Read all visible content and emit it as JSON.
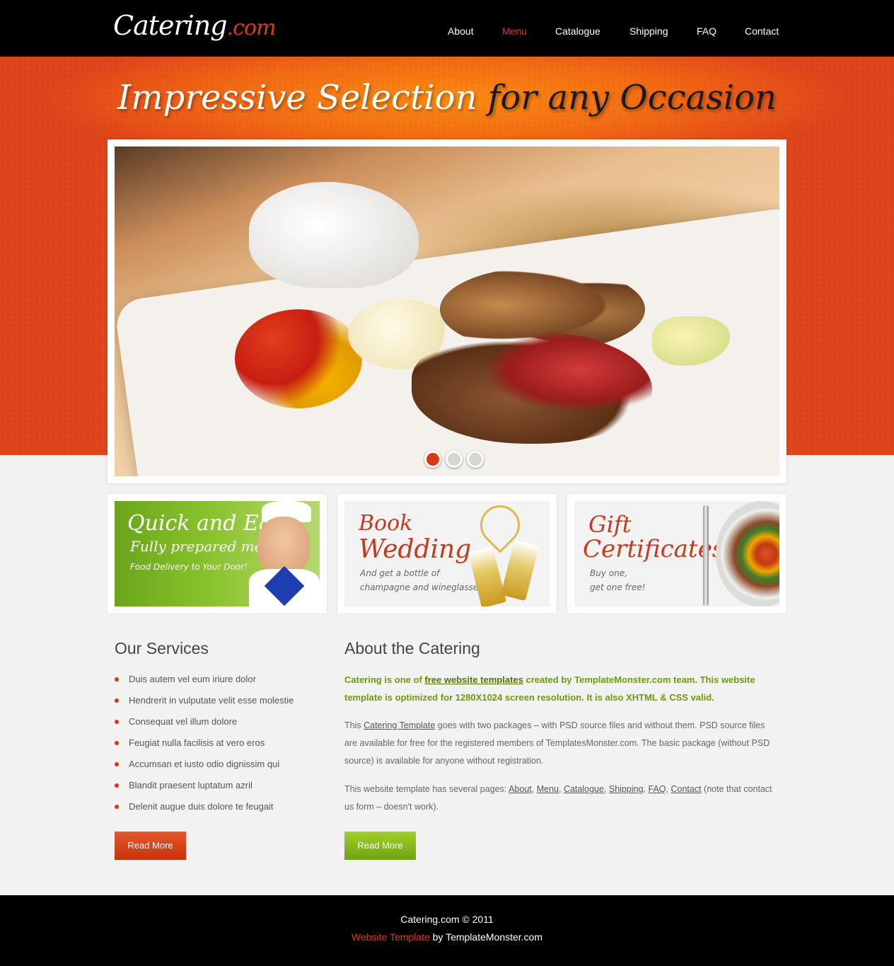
{
  "header": {
    "logo_main": "Catering",
    "logo_suffix": ".com",
    "nav": [
      {
        "label": "About"
      },
      {
        "label": "Menu"
      },
      {
        "label": "Catalogue"
      },
      {
        "label": "Shipping"
      },
      {
        "label": "FAQ"
      },
      {
        "label": "Contact"
      }
    ],
    "active_nav": "Menu"
  },
  "hero": {
    "tagline_part1": "Impressive Selection",
    "tagline_part2": "for any Occasion",
    "slide_count": 3,
    "active_slide": 1
  },
  "promos": [
    {
      "title1": "Quick and Easy",
      "title2": "Fully prepared meals",
      "text": "Food Delivery to Your Door!"
    },
    {
      "title1": "Book",
      "title2": "Wedding",
      "text1": "And get a bottle of",
      "text2": "champagne and wineglasses"
    },
    {
      "title1": "Gift",
      "title2": "Certificates",
      "text1": "Buy one,",
      "text2": "get one free!"
    }
  ],
  "services": {
    "heading": "Our Services",
    "items": [
      "Duis autem vel eum iriure dolor",
      "Hendrerit in vulputate velit esse molestie",
      "Consequat vel illum dolore",
      "Feugiat nulla facilisis at vero eros",
      "Accumsan et iusto odio dignissim qui",
      "Blandit praesent luptatum azril",
      "Delenit augue duis dolore te feugait"
    ],
    "button": "Read More"
  },
  "about": {
    "heading": "About the Catering",
    "lead_pre": "Catering is one of ",
    "lead_link": "free website templates",
    "lead_post": " created by TemplateMonster.com team. This website template is optimized for 1280X1024 screen resolution. It is also XHTML & CSS valid.",
    "p1_pre": "This ",
    "p1_link": "Catering Template",
    "p1_post": " goes with two packages – with PSD source files and without them. PSD source files are available for free for the registered members of TemplatesMonster.com. The basic package (without PSD source) is available for anyone without registration.",
    "p2_pre": "This website template has several pages: ",
    "p2_links": [
      "About",
      "Menu",
      "Catalogue",
      "Shipping",
      "FAQ",
      "Contact"
    ],
    "p2_post": " (note that contact us form – doesn't work).",
    "button": "Read More"
  },
  "footer": {
    "copyright": "Catering.com © 2011",
    "credit_link": "Website Template",
    "credit_post": " by TemplateMonster.com"
  },
  "colors": {
    "accent_red": "#e0391a",
    "green": "#6c9b0b",
    "orange_band": "#f26a14"
  }
}
